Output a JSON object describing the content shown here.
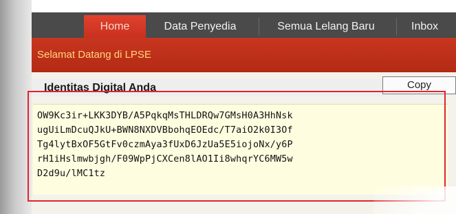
{
  "nav": {
    "tabs": [
      {
        "label": "Home",
        "active": true
      },
      {
        "label": "Data Penyedia",
        "active": false
      },
      {
        "label": "Semua Lelang Baru",
        "active": false
      },
      {
        "label": "Inbox",
        "active": false
      }
    ]
  },
  "welcome": {
    "text": "Selamat Datang di LPSE"
  },
  "panel": {
    "title": "Identitas Digital Anda",
    "copy_label": "Copy",
    "certificate_text": "OW9Kc3ir+LKK3DYB/A5PqkqMsTHLDRQw7GMsH0A3HhNsk\nugUiLmDcuQJkU+BWN8NXDVBbohqEOEdc/T7aiO2k0I3Of\nTg4lytBxOF5GtFv0czmAya3fUxD6JzUa5E5iojoNx/y6P\nrH1iHslmwbjgh/F09WpPjCXCen8lAO1Ii8whqrYC6MW5w\nD2d9u/lMC1tz"
  },
  "colors": {
    "nav_bg": "#4a4a4a",
    "active_tab": "#d23a26",
    "welcome_bg": "#b93019",
    "welcome_text": "#ffd77a",
    "highlight": "#e2232b"
  }
}
